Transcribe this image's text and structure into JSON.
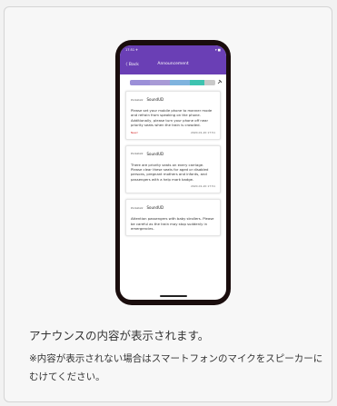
{
  "phone": {
    "status_time": "17:51 ✈",
    "status_right": "▾ ■",
    "back_label": "〈 Back",
    "title": "Announcement",
    "progress_colors": [
      "#9b8fd8",
      "#a89ad6",
      "#7fb3de",
      "#3ec3b0",
      "#c9c9c9"
    ],
    "messages": [
      {
        "logo": "Pocketalk",
        "app": "SoundUD",
        "body": "Please set your mobile phone to manner mode and refrain from speaking on the phone. Additionally, please turn your phone off near priority seats when the train is crowded.",
        "badge": "New!",
        "time": "2020-01-20 17:51"
      },
      {
        "logo": "Pocketalk",
        "app": "SoundUD",
        "body": "There are priority seats on every carriage. Please clear these seats for aged or disabled persons, pregnant mothers and infants, and passengers with a help mark badge.",
        "badge": "",
        "time": "2020-01-20 17:51"
      },
      {
        "logo": "Pocketalk",
        "app": "SoundUD",
        "body": "Attention passengers with baby strollers. Please be careful as the train may stop suddenly in emergencies.",
        "badge": "",
        "time": ""
      }
    ]
  },
  "caption": {
    "line1": "アナウンスの内容が表示されます。",
    "line2": "※内容が表示されない場合はスマートフォンのマイクをスピーカーにむけてください。"
  }
}
